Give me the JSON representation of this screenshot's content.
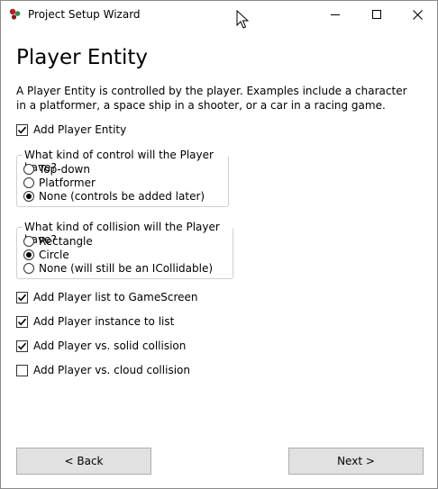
{
  "window": {
    "title": "Project Setup Wizard"
  },
  "page": {
    "heading": "Player Entity",
    "description": "A Player Entity is controlled by the player. Examples include a character in a platformer, a space ship in a shooter, or a car in a racing game."
  },
  "add_player_entity": {
    "label": "Add Player Entity",
    "checked": true
  },
  "control_group": {
    "legend": "What kind of control will the Player have?",
    "options": [
      {
        "label": "Top-down",
        "selected": false
      },
      {
        "label": "Platformer",
        "selected": false
      },
      {
        "label": "None (controls be added later)",
        "selected": true
      }
    ]
  },
  "collision_group": {
    "legend": "What kind of collision will the Player have?",
    "options": [
      {
        "label": "Rectangle",
        "selected": false
      },
      {
        "label": "Circle",
        "selected": true
      },
      {
        "label": "None (will still be an ICollidable)",
        "selected": false
      }
    ]
  },
  "options": [
    {
      "label": "Add Player list to GameScreen",
      "checked": true
    },
    {
      "label": "Add Player instance to list",
      "checked": true
    },
    {
      "label": "Add Player vs. solid collision",
      "checked": true
    },
    {
      "label": "Add Player vs. cloud collision",
      "checked": false
    }
  ],
  "buttons": {
    "back": "< Back",
    "next": "Next >"
  },
  "icons": {
    "app": "app-icon",
    "minimize": "minimize-icon",
    "maximize": "maximize-icon",
    "close": "close-icon",
    "check": "checkmark-icon"
  }
}
